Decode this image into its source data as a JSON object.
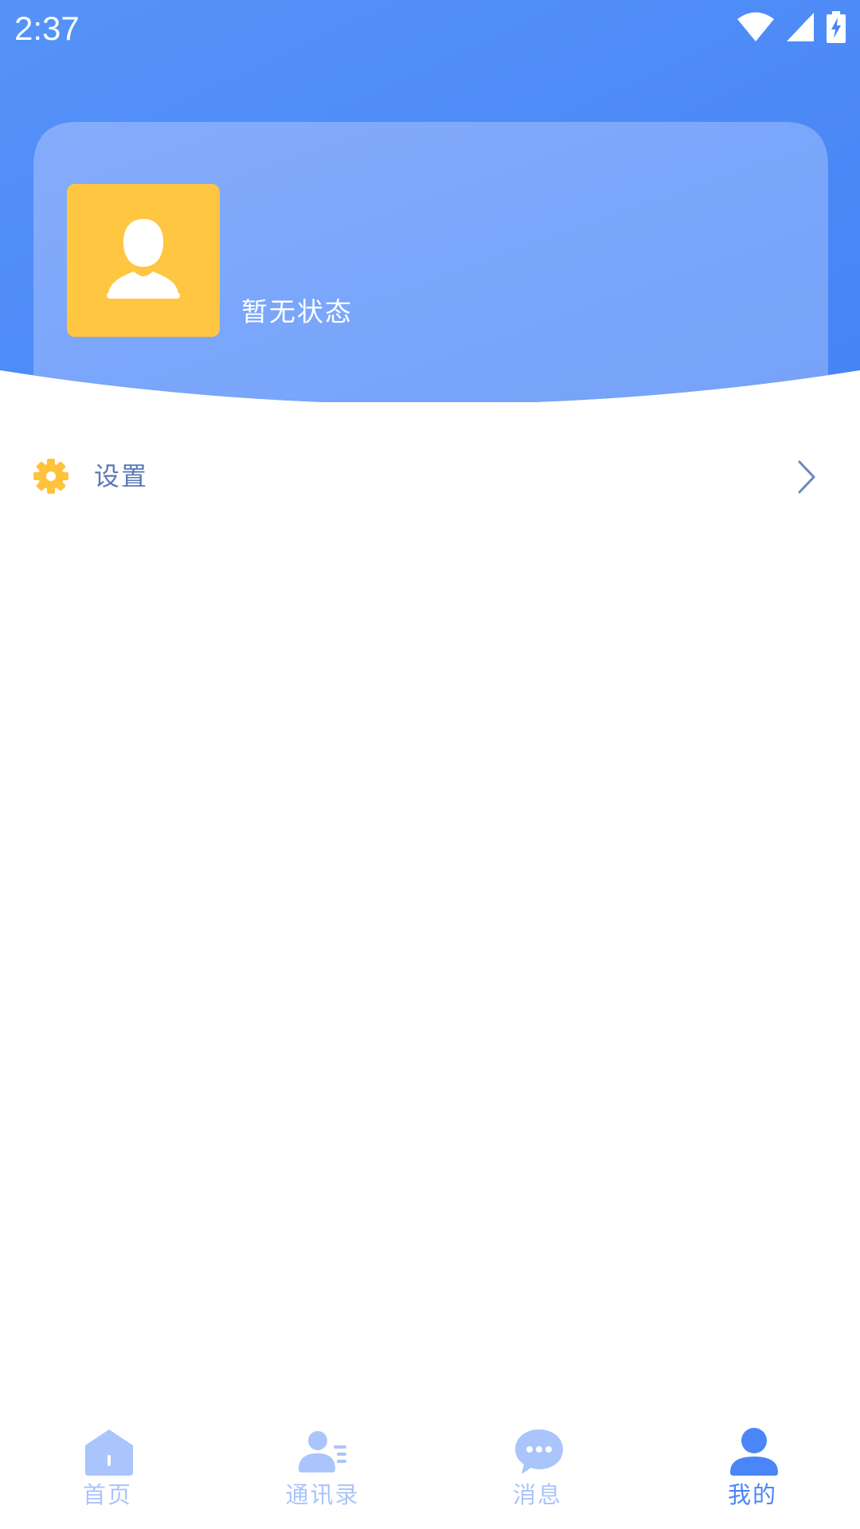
{
  "colors": {
    "header_blue": "#4a86f7",
    "card_blue": "#7aa6fb",
    "avatar_yellow": "#ffc642",
    "gear_yellow": "#ffc23a",
    "menu_text": "#5a78b8",
    "nav_inactive": "#a9c5fb",
    "nav_active": "#4a86f7"
  },
  "status_bar": {
    "time": "2:37",
    "icons": [
      "wifi-icon",
      "cellular-signal-icon",
      "battery-charging-icon"
    ]
  },
  "profile": {
    "avatar_icon": "default-avatar-icon",
    "status_text": "暂无状态"
  },
  "menu": {
    "items": [
      {
        "label": "设置",
        "icon": "gear-icon",
        "arrow": "chevron-right-icon"
      }
    ]
  },
  "bottom_nav": {
    "items": [
      {
        "label": "首页",
        "icon": "home-icon",
        "active": false
      },
      {
        "label": "通讯录",
        "icon": "contacts-icon",
        "active": false
      },
      {
        "label": "消息",
        "icon": "chat-bubble-icon",
        "active": false
      },
      {
        "label": "我的",
        "icon": "profile-icon",
        "active": true
      }
    ]
  }
}
